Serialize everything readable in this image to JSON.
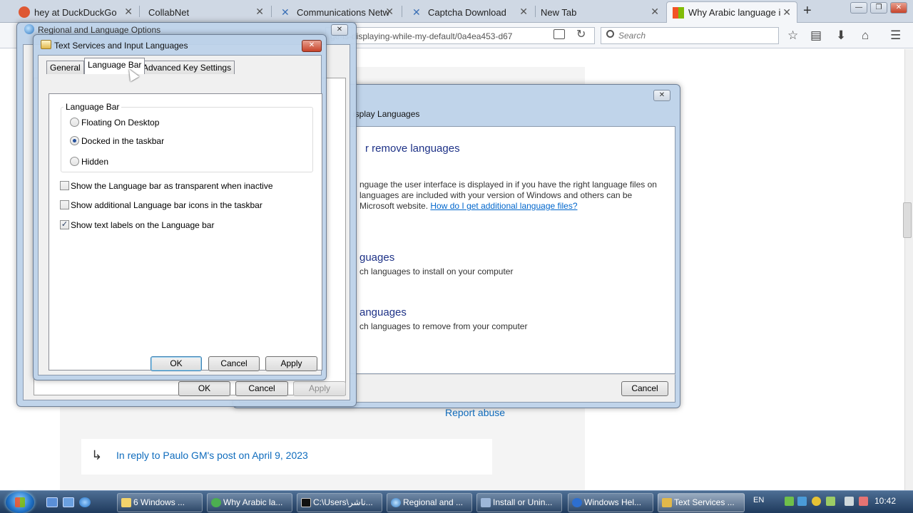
{
  "browser": {
    "tabs": [
      {
        "label": "hey at DuckDuckGo",
        "color": "#de5833"
      },
      {
        "label": "CollabNet",
        "color": "#ffffff"
      },
      {
        "label": "Communications Netw",
        "color": "#3a6fb6"
      },
      {
        "label": "Captcha Download",
        "color": "#3a6fb6"
      },
      {
        "label": "New Tab",
        "color": "#ffffff"
      },
      {
        "label": "Why Arabic language i",
        "color": "#f35325"
      }
    ],
    "new_tab_glyph": "+",
    "window_min": "—",
    "window_max": "❐",
    "window_close": "✕",
    "url": "ge-is-displaying-while-my-default/0a4ea453-d67",
    "search_placeholder": "Search",
    "icons": [
      "reader-view-icon",
      "reload-icon",
      "search-icon",
      "bookmark-star-icon",
      "bookmarks-list-icon",
      "download-icon",
      "home-icon",
      "menu-icon"
    ]
  },
  "page": {
    "report_abuse": "Report abuse",
    "reply_text": "In reply to Paulo GM's post on April 9, 2023",
    "reply_glyph": "↳"
  },
  "display_dialog": {
    "close_glyph": "✕",
    "title": "isplay Languages",
    "heading": "r remove languages",
    "desc_line1": "nguage the user interface is displayed in if you have the right language files on",
    "desc_line2": "languages are included with your version of Windows and others can be",
    "desc_line3_prefix": "Microsoft website.",
    "desc_link": "How do I get additional language files?",
    "install_heading": "guages",
    "install_desc": "ch languages to install on your computer",
    "remove_heading": "anguages",
    "remove_desc": "ch languages to remove from your computer",
    "cancel": "Cancel"
  },
  "regional_dialog": {
    "title": "Regional and Language Options",
    "close_glyph": "✕",
    "ok": "OK",
    "cancel": "Cancel",
    "apply": "Apply"
  },
  "text_dialog": {
    "title": "Text Services and Input Languages",
    "close_glyph": "✕",
    "tabs": [
      "General",
      "Language Bar",
      "Advanced Key Settings"
    ],
    "group_label": "Language Bar",
    "radio_floating": "Floating On Desktop",
    "radio_docked": "Docked in the taskbar",
    "radio_hidden": "Hidden",
    "chk_transparent": "Show the Language bar as transparent when inactive",
    "chk_additional": "Show additional Language bar icons in the taskbar",
    "chk_text_labels": "Show text labels on the Language bar",
    "check_glyph": "✓",
    "ok": "OK",
    "cancel": "Cancel",
    "apply": "Apply"
  },
  "taskbar": {
    "tasks": [
      {
        "label": "6 Windows ..."
      },
      {
        "label": "Why Arabic la..."
      },
      {
        "label": "C:\\Users\\ناشر..."
      },
      {
        "label": "Regional and ..."
      },
      {
        "label": "Install or Unin..."
      },
      {
        "label": "Windows Hel..."
      },
      {
        "label": "Text Services ..."
      }
    ],
    "lang": "EN",
    "clock": "10:42"
  }
}
